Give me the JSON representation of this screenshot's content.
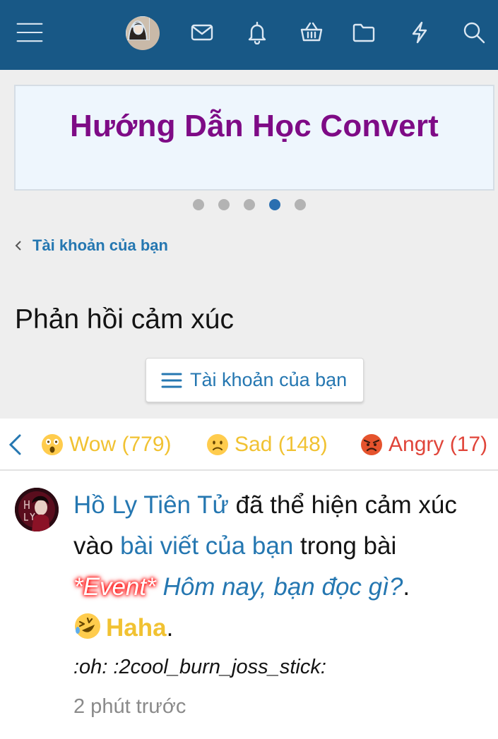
{
  "banner": {
    "title": "Hướng Dẫn Học Convert",
    "dots": 5,
    "active_dot": 4
  },
  "breadcrumb": {
    "label": "Tài khoản của bạn"
  },
  "page_title": "Phản hồi cảm xúc",
  "account_button": {
    "label": "Tài khoản của bạn"
  },
  "tabs": [
    {
      "label": "Wow (779)",
      "emoji": "wow-emoji"
    },
    {
      "label": "Sad (148)",
      "emoji": "sad-emoji"
    },
    {
      "label": "Angry (17)",
      "emoji": "angry-emoji"
    }
  ],
  "alert": {
    "user": "Hồ Ly Tiên Tử",
    "text1": " đã thể hiện cảm xúc vào ",
    "post_link": "bài viết của bạn",
    "text2": " trong bài ",
    "event_prefix": "*Event*",
    "thread_title": " Hôm nay, bạn đọc gì?",
    "dot1": ".",
    "reaction": "Haha",
    "dot2": ".",
    "snippet": ":oh: :2cool_burn_joss_stick:",
    "time": "2 phút trước"
  },
  "colors": {
    "topbar": "#185886",
    "link": "#2577b1",
    "banner_title": "#7e0b86",
    "reaction": "#f1c232",
    "angry": "#e0453a"
  }
}
